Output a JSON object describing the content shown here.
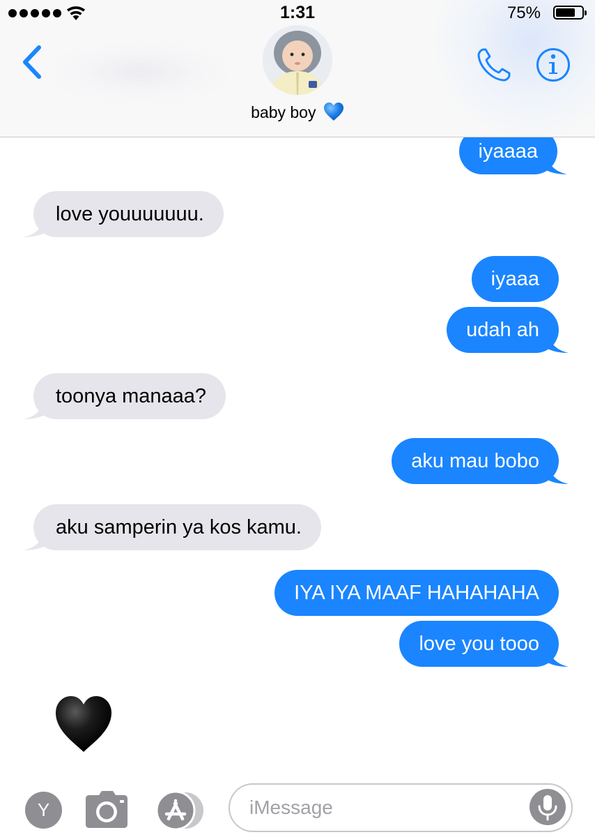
{
  "status_bar": {
    "time": "1:31",
    "battery_percent": "75%",
    "battery_level": 0.75,
    "signal_bars": 5
  },
  "header": {
    "contact_name": "baby boy",
    "contact_emoji_icon": "blue-heart-icon",
    "back_icon": "chevron-left-icon",
    "call_icon": "phone-icon",
    "info_icon": "info-icon"
  },
  "messages": [
    {
      "direction": "outgoing",
      "text": "iyaaaa"
    },
    {
      "direction": "incoming",
      "text": "love youuuuuuu."
    },
    {
      "direction": "outgoing",
      "text": "iyaaa"
    },
    {
      "direction": "outgoing",
      "text": "udah ah"
    },
    {
      "direction": "incoming",
      "text": "toonya manaaa?"
    },
    {
      "direction": "outgoing",
      "text": "aku mau bobo"
    },
    {
      "direction": "incoming",
      "text": "aku samperin ya kos kamu."
    },
    {
      "direction": "outgoing",
      "text": "IYA IYA MAAF HAHAHAHA"
    },
    {
      "direction": "outgoing",
      "text": "love you tooo"
    },
    {
      "direction": "incoming",
      "emoji": "black-heart-icon"
    }
  ],
  "input_bar": {
    "y_button_label": "Y",
    "placeholder": "iMessage",
    "value": "",
    "camera_icon": "camera-icon",
    "apps_icon": "app-store-icon",
    "mic_icon": "microphone-icon"
  },
  "colors": {
    "accent": "#1a85ff",
    "incoming_bubble": "#e6e5eb",
    "icon_gray": "#8e8e93"
  }
}
